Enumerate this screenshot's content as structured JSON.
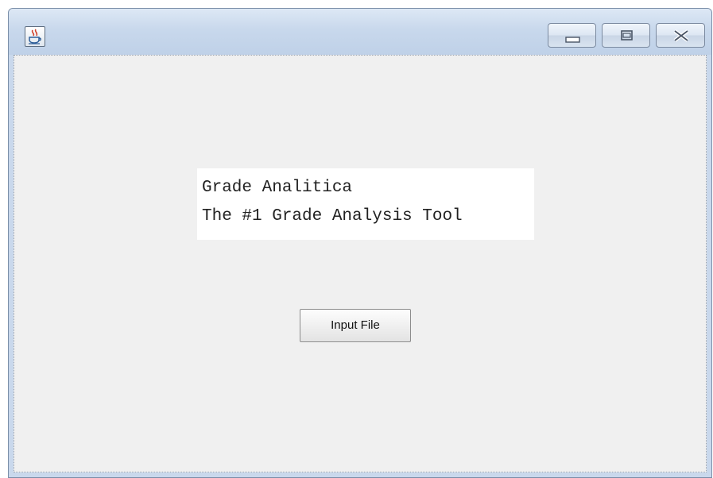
{
  "window": {
    "icon": "java-icon",
    "controls": {
      "minimize": "minimize-icon",
      "maximize": "maximize-icon",
      "close": "close-icon"
    }
  },
  "content": {
    "title_line1": "Grade Analitica",
    "title_line2": "The #1 Grade Analysis Tool",
    "input_button_label": "Input File"
  },
  "colors": {
    "titlebar": "#c8d8ec",
    "client_background": "#f0f0f0",
    "label_background": "#ffffff"
  }
}
